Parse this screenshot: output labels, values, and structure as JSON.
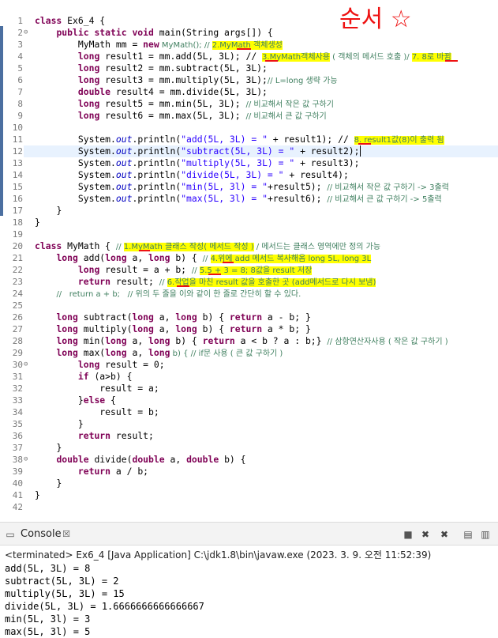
{
  "editor": {
    "line_numbers": [
      "1",
      "2",
      "3",
      "4",
      "5",
      "6",
      "7",
      "8",
      "9",
      "10",
      "11",
      "12",
      "13",
      "14",
      "15",
      "16",
      "17",
      "18",
      "19",
      "20",
      "21",
      "22",
      "23",
      "24",
      "25",
      "26",
      "27",
      "28",
      "29",
      "30",
      "31",
      "32",
      "33",
      "34",
      "35",
      "36",
      "37",
      "38",
      "39",
      "40",
      "41",
      "42"
    ],
    "l1": "class Ex6_4 {",
    "l2a": "public static void ",
    "l2b": "main(String args[]) {",
    "l3a": "MyMath mm = ",
    "l3b": "new",
    "l3c": " MyMath(); // ",
    "l3h": "2.MyMath 객체생성",
    "l4a": "long",
    "l4b": " result1 = mm.add(5L, 3L); // ",
    "l4h": "3.MyMath객체사용",
    "l4c": " ( 객체의 메서드 호출 )/ ",
    "l4h2": "7. 8로 바뀜",
    "l5a": "long",
    "l5b": " result2 = mm.subtract(5L, 3L);",
    "l6a": "long",
    "l6b": " result3 = mm.multiply(5L, 3L);",
    "l6c": "// L=long 생략 가능",
    "l7a": "double",
    "l7b": " result4 = mm.divide(5L, 3L);",
    "l8a": "long",
    "l8b": " result5 = mm.min(5L, 3L); ",
    "l8c": "// 비교해서 작은 값 구하기",
    "l9a": "long",
    "l9b": " result6 = mm.max(5L, 3L); ",
    "l9c": "// 비교해서 큰 값 구하기",
    "sys": "System.",
    "out": "out",
    "println": ".println(",
    "l11s": "\"add(5L, 3L) = \"",
    "l11b": " + result1); // ",
    "l11h": "8. result1값(8)이 출력 됨",
    "l12s": "\"subtract(5L, 3L) = \"",
    "l12b": " + result2);",
    "l13s": "\"multiply(5L, 3L) = \"",
    "l13b": " + result3);",
    "l14s": "\"divide(5L, 3L) = \"",
    "l14b": " + result4);",
    "l15s": "\"min(5L, 3l) = \"",
    "l15b": "+result5); ",
    "l15c": "// 비교해서 작은 값 구하기 -> 3출력",
    "l16s": "\"max(5L, 3l) = \"",
    "l16b": "+result6); ",
    "l16c": "// 비교해서 큰 값 구하기 -> 5출력",
    "brace_close": "}",
    "l20a": "class",
    "l20b": " MyMath { // ",
    "l20h": "1.MyMath 클래스 작성( 메서드 작성 )",
    "l20c": " / 메서드는 클래스 영역에만 정의 가능",
    "l21a": "long",
    "l21b": " add(",
    "l21c": " a, ",
    "l21d": " b) { // ",
    "l21h": "4.위에 add 메서드 복사해옴 long 5L, long 3L",
    "l22a": "long",
    "l22b": " result = a + b; // ",
    "l22h": "5.5 + 3 = 8; 8값을 result 저장",
    "l23a": "return",
    "l23b": " result; // ",
    "l23h": "6.작업을 마친 result 값을 호출한 곳 (add메서드로 다시 보냄)",
    "l24": "//   return a + b;   // 위의 두 줄을 이와 같이 한 줄로 간단히 할 수 있다.",
    "l26b": " subtract(",
    "l26r": "return",
    "l26e": " a - b; }",
    "l27b": " multiply(",
    "l27e": " a * b; }",
    "l28b": " min(",
    "l28e": " a < b ? a : b;} ",
    "l28c": "// 삼항연산자사용 ( 작은 값 구하기 )",
    "l29b": " max(",
    "l29c": " b) { // if문 사용 ( 큰 값 구하기 )",
    "l30b": " result = 0;",
    "l31a": "if",
    "l31b": " (a>b) {",
    "l32": "result = a;",
    "l33a": "}",
    "l33b": "else",
    "l33c": " {",
    "l34": "result = b;",
    "l36b": " result;",
    "l38a": "double",
    "l38b": " divide(",
    "l38c": " a, ",
    "l38d": " b) {",
    "l39b": " a / b;",
    "kw_long": "long",
    "kw_return": "return"
  },
  "handwriting": "순서 ☆",
  "console": {
    "tab_label": "Console",
    "tab_close": "☒",
    "terminated": "<terminated> Ex6_4 [Java Application] C:\\jdk1.8\\bin\\javaw.exe (2023. 3. 9. 오전 11:52:39)",
    "output": [
      "add(5L, 3L) = 8",
      "subtract(5L, 3L) = 2",
      "multiply(5L, 3L) = 15",
      "divide(5L, 3L) = 1.6666666666666667",
      "min(5L, 3l) = 3",
      "max(5L, 3l) = 5"
    ]
  },
  "colors": {
    "highlight": "#ffff00",
    "keyword": "#7f0055",
    "string": "#2a00ff",
    "comment": "#3f7f5f",
    "field": "#0000c0"
  }
}
